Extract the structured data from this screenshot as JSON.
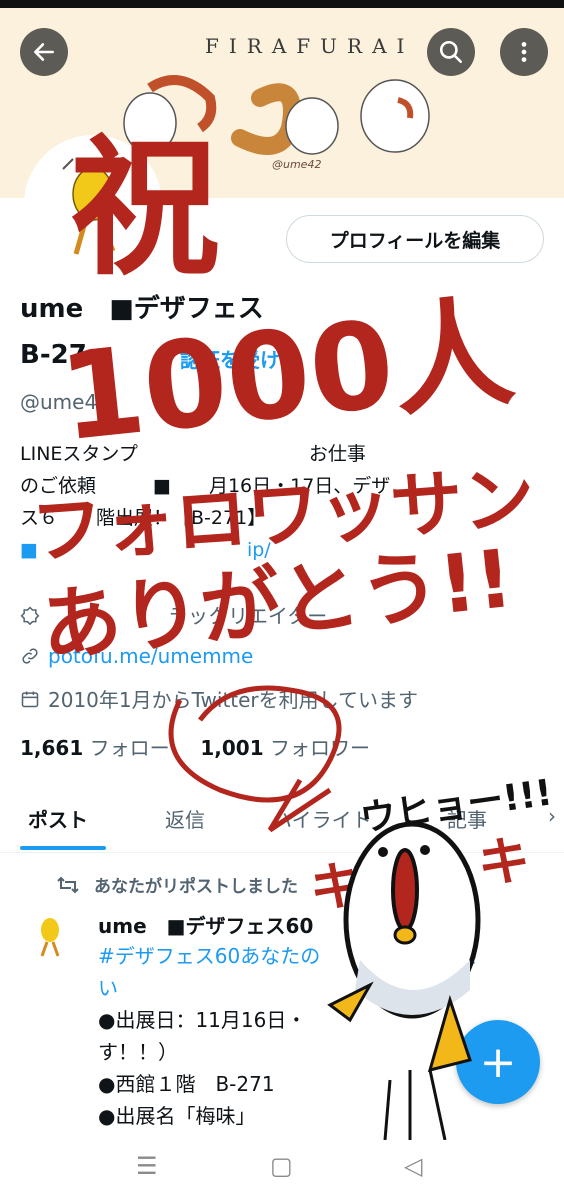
{
  "header": {
    "banner_text": "FIRAFURAI",
    "banner_credit": "@ume42",
    "back_icon": "arrow-left-icon",
    "search_icon": "search-icon",
    "more_icon": "more-vertical-icon"
  },
  "profile": {
    "edit_button": "プロフィールを編集",
    "name_line1": "ume　■デザフェス",
    "name_line2": "B-27",
    "verify_text": "認証を受ける",
    "handle": "@ume4",
    "bio_line1": "LINEスタンプ　　　　　　　　　お仕事",
    "bio_line2": "のご依頼　　　■　　月16日・17日、デザ",
    "bio_line3": "ス６　　階出展！【B-271】",
    "bio_link": "■　　　　　　　　　　　ip/",
    "category": "　　　　　　ラックリエイター",
    "url": "potofu.me/umemme",
    "joined": "2010年1月からTwitterを利用しています",
    "following_count": "1,661",
    "following_label": "フォロー",
    "followers_count": "1,001",
    "followers_label": "フォロワー"
  },
  "tabs": [
    {
      "label": "ポスト"
    },
    {
      "label": "返信"
    },
    {
      "label": "ハイライト"
    },
    {
      "label": "記事"
    }
  ],
  "post": {
    "repost_text": "あなたがリポストしました",
    "author": "ume　■デザフェス60",
    "hashtag": "#デザフェス60あなたの　　　　てくださ",
    "line2": "い",
    "line3": "●出展日：11月16日・",
    "line4": "す！！）",
    "line5": "●西館１階　B-271",
    "line6": "●出展名「梅味」"
  },
  "fab": {
    "label": "+"
  },
  "overlay_text": {
    "big1": "祝",
    "big2": "1000人",
    "big3": "フォロワッサン",
    "big4": "ありがとう!!",
    "shout": "ウヒョー!!!",
    "ki": "キ"
  },
  "colors": {
    "accent": "#1d9bf0",
    "ink": "#b3261e"
  }
}
